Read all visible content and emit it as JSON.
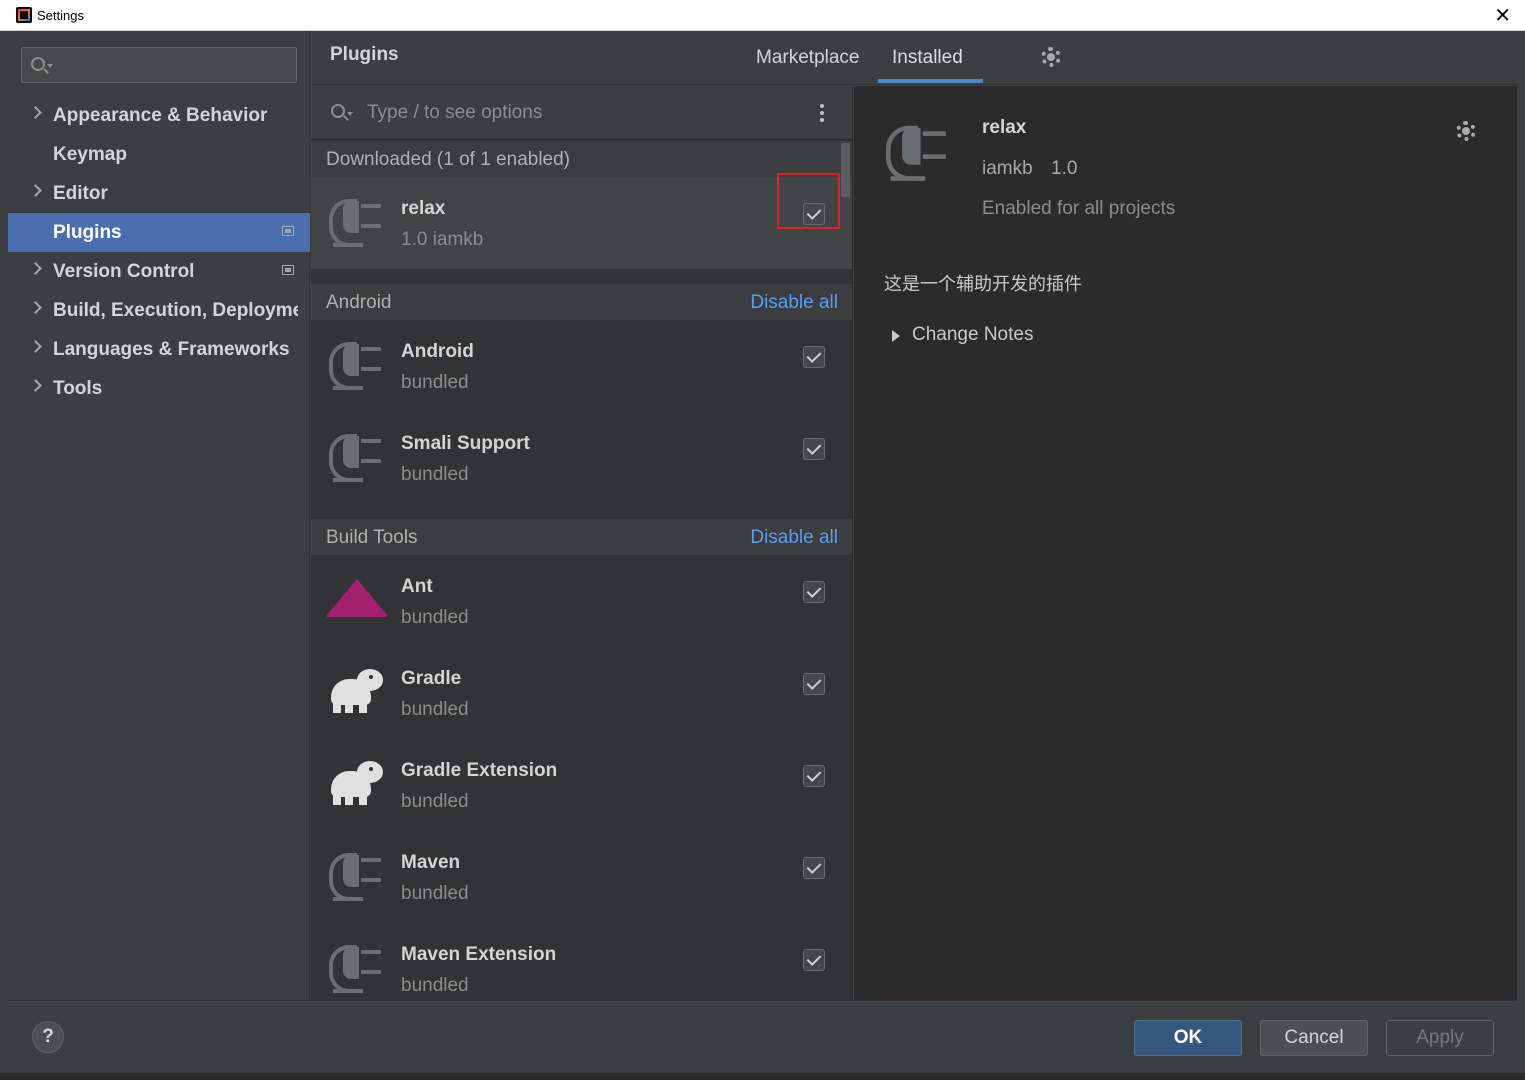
{
  "window": {
    "title": "Settings",
    "close_glyph": "✕"
  },
  "sidebar": {
    "search_placeholder": "",
    "items": [
      {
        "label": "Appearance & Behavior",
        "expandable": true
      },
      {
        "label": "Keymap",
        "expandable": false
      },
      {
        "label": "Editor",
        "expandable": true
      },
      {
        "label": "Plugins",
        "expandable": false,
        "selected": true
      },
      {
        "label": "Version Control",
        "expandable": true
      },
      {
        "label": "Build, Execution, Deployment",
        "expandable": true
      },
      {
        "label": "Languages & Frameworks",
        "expandable": true
      },
      {
        "label": "Tools",
        "expandable": true
      }
    ]
  },
  "header": {
    "title": "Plugins",
    "tabs": [
      {
        "label": "Marketplace",
        "active": false
      },
      {
        "label": "Installed",
        "active": true
      }
    ]
  },
  "plugin_list": {
    "search_placeholder": "Type / to see options",
    "groups": [
      {
        "label": "Downloaded (1 of 1 enabled)",
        "action": "",
        "plugins": [
          {
            "name": "relax",
            "sub": "1.0  iamkb",
            "enabled": true,
            "icon": "plug-icon",
            "selected": true
          }
        ]
      },
      {
        "label": "Android",
        "action": "Disable all",
        "plugins": [
          {
            "name": "Android",
            "sub": "bundled",
            "enabled": true,
            "icon": "plug-icon"
          },
          {
            "name": "Smali Support",
            "sub": "bundled",
            "enabled": true,
            "icon": "plug-icon"
          }
        ]
      },
      {
        "label": "Build Tools",
        "action": "Disable all",
        "plugins": [
          {
            "name": "Ant",
            "sub": "bundled",
            "enabled": true,
            "icon": "ant-icon"
          },
          {
            "name": "Gradle",
            "sub": "bundled",
            "enabled": true,
            "icon": "gradle-elephant-icon"
          },
          {
            "name": "Gradle Extension",
            "sub": "bundled",
            "enabled": true,
            "icon": "gradle-elephant-icon"
          },
          {
            "name": "Maven",
            "sub": "bundled",
            "enabled": true,
            "icon": "plug-icon"
          },
          {
            "name": "Maven Extension",
            "sub": "bundled",
            "enabled": true,
            "icon": "plug-icon"
          }
        ]
      }
    ]
  },
  "detail": {
    "name": "relax",
    "vendor": "iamkb",
    "version": "1.0",
    "status": "Enabled for all projects",
    "description": "这是一个辅助开发的插件",
    "change_notes_label": "Change Notes"
  },
  "footer": {
    "help_label": "?",
    "ok_label": "OK",
    "cancel_label": "Cancel",
    "apply_label": "Apply"
  },
  "colors": {
    "selection": "#4b6eaf",
    "link": "#589df6",
    "highlight": "#e02020",
    "ok_button": "#365880"
  }
}
